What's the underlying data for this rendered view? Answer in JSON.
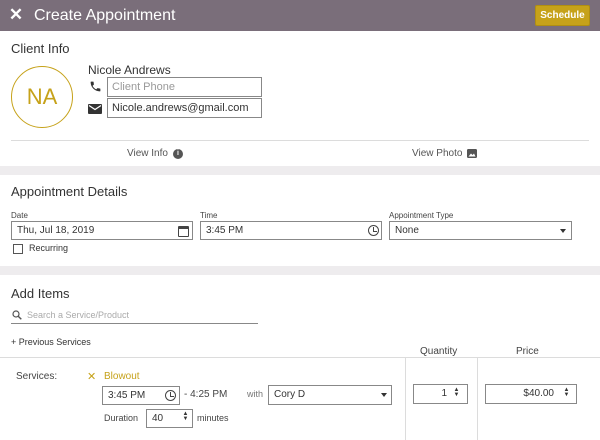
{
  "header": {
    "title": "Create Appointment",
    "schedule_label": "Schedule"
  },
  "client_info": {
    "section_title": "Client Info",
    "initials": "NA",
    "name": "Nicole Andrews",
    "phone_placeholder": "Client Phone",
    "email_value": "Nicole.andrews@gmail.com",
    "view_info_label": "View Info",
    "view_photo_label": "View Photo"
  },
  "appointment_details": {
    "section_title": "Appointment Details",
    "date_label": "Date",
    "date_value": "Thu, Jul 18, 2019",
    "time_label": "Time",
    "time_value": "3:45 PM",
    "type_label": "Appointment Type",
    "type_value": "None",
    "recurring_label": "Recurring",
    "recurring_checked": false
  },
  "add_items": {
    "section_title": "Add Items",
    "search_placeholder": "Search a Service/Product",
    "previous_services_label": "+ Previous Services",
    "quantity_header": "Quantity",
    "price_header": "Price",
    "services_label": "Services:",
    "service": {
      "remove_symbol": "✕",
      "name": "Blowout",
      "start_time": "3:45 PM",
      "end_time": "- 4:25 PM",
      "with_label": "with",
      "staff": "Cory D",
      "duration_label": "Duration",
      "duration_value": "40",
      "minutes_label": "minutes",
      "quantity": "1",
      "price": "$40.00"
    }
  },
  "colors": {
    "header_bg": "#7a6e7a",
    "accent": "#c6a21a",
    "band": "#eeecee"
  }
}
